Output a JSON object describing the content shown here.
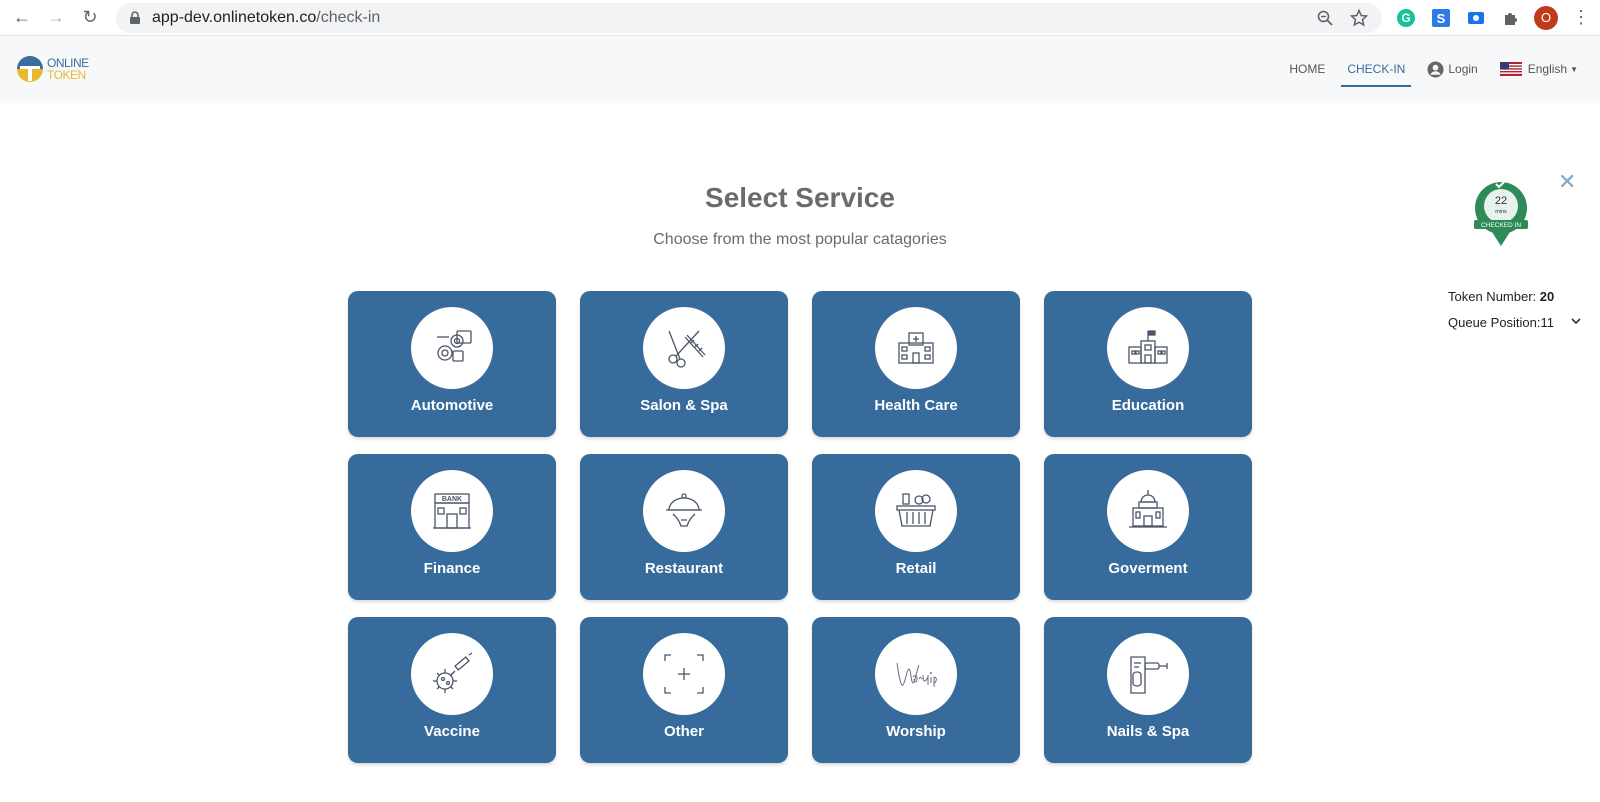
{
  "browser": {
    "url_host": "app-dev.onlinetoken.co",
    "url_path": "/check-in",
    "avatar_letter": "O"
  },
  "header": {
    "logo": {
      "line1": "ONLINE",
      "line2": "TOKEN"
    },
    "nav": {
      "home": "HOME",
      "checkin": "CHECK-IN",
      "login": "Login",
      "language": "English"
    },
    "accent_color": "#366b9c"
  },
  "main": {
    "title": "Select Service",
    "subtitle": "Choose from the most popular catagories",
    "categories": [
      {
        "label": "Automotive",
        "icon": "automotive-icon"
      },
      {
        "label": "Salon & Spa",
        "icon": "scissors-comb-icon"
      },
      {
        "label": "Health Care",
        "icon": "hospital-icon"
      },
      {
        "label": "Education",
        "icon": "school-building-icon"
      },
      {
        "label": "Finance",
        "icon": "bank-icon"
      },
      {
        "label": "Restaurant",
        "icon": "cloche-icon"
      },
      {
        "label": "Retail",
        "icon": "shopping-basket-icon"
      },
      {
        "label": "Goverment",
        "icon": "government-building-icon"
      },
      {
        "label": "Vaccine",
        "icon": "virus-syringe-icon"
      },
      {
        "label": "Other",
        "icon": "plus-frame-icon"
      },
      {
        "label": "Worship",
        "icon": "worship-script-icon"
      },
      {
        "label": "Nails & Spa",
        "icon": "nail-drill-icon"
      }
    ]
  },
  "token": {
    "badge_minutes": "22",
    "badge_unit": "mins",
    "badge_status": "CHECKED IN",
    "token_number_label": "Token Number:",
    "token_number": "20",
    "queue_position_label": "Queue Position:",
    "queue_position": "11"
  }
}
